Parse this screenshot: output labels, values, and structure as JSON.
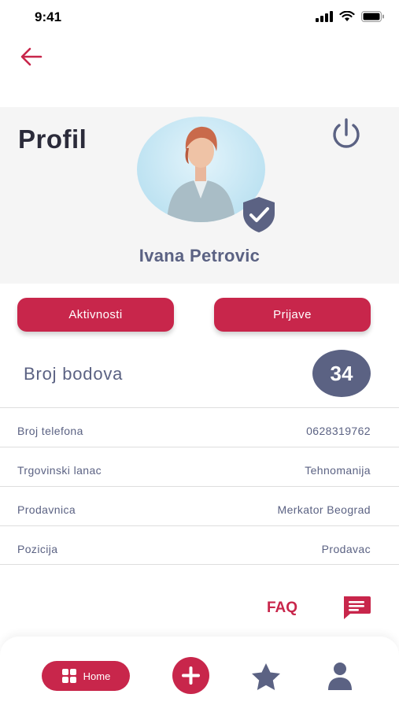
{
  "status_bar": {
    "time": "9:41"
  },
  "header": {
    "title": "Profil"
  },
  "user": {
    "name": "Ivana Petrovic"
  },
  "actions": {
    "activities_label": "Aktivnosti",
    "signups_label": "Prijave"
  },
  "points": {
    "label": "Broj bodova",
    "value": "34"
  },
  "info": [
    {
      "key": "Broj telefona",
      "value": "0628319762"
    },
    {
      "key": "Trgovinski lanac",
      "value": "Tehnomanija"
    },
    {
      "key": "Prodavnica",
      "value": "Merkator Beograd"
    },
    {
      "key": "Pozicija",
      "value": "Prodavac"
    }
  ],
  "footer": {
    "faq_label": "FAQ"
  },
  "nav": {
    "home_label": "Home"
  },
  "icons": {
    "back": "arrow-left-icon",
    "power": "power-icon",
    "verified": "shield-check-icon",
    "chat": "chat-bubble-icon",
    "home": "grid-icon",
    "add": "plus-icon",
    "favorites": "star-icon",
    "profile": "person-icon"
  },
  "colors": {
    "accent": "#c8264b",
    "primary_text": "#5b6283",
    "header_bg": "#f5f5f5"
  }
}
